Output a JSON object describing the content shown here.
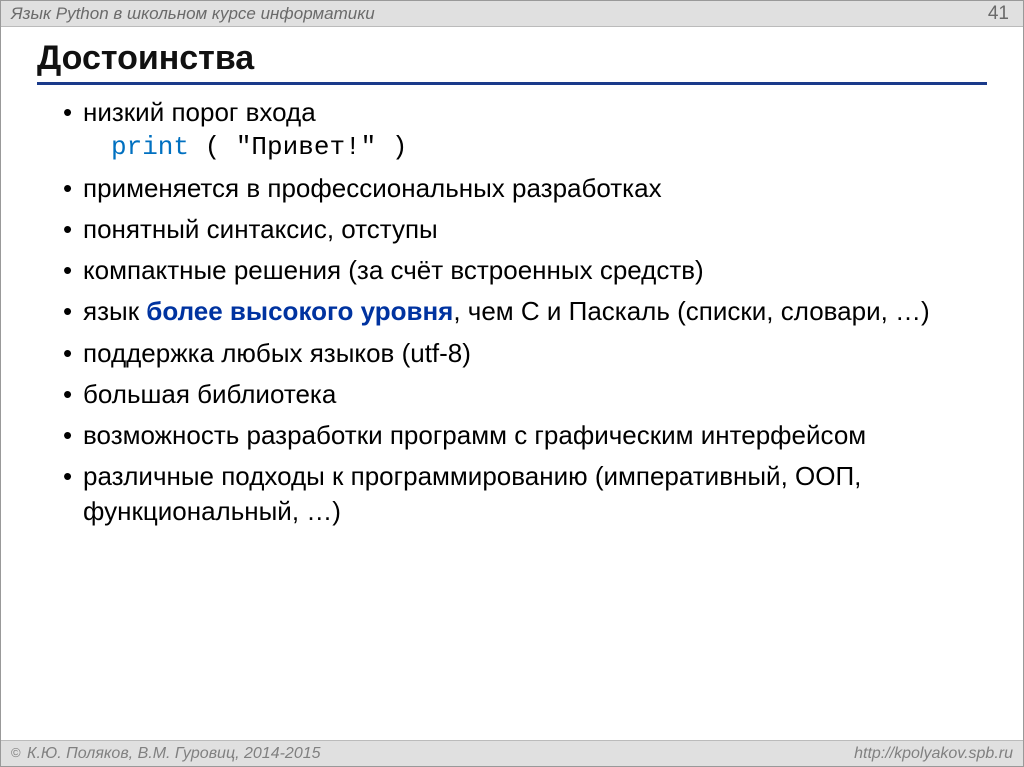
{
  "header": {
    "title": "Язык Python в школьном курсе информатики",
    "page": "41"
  },
  "title": "Достоинства",
  "bullets": {
    "b1_text": "низкий порог входа",
    "b1_code_kw": "print",
    "b1_code_rest": " ( \"Привет!\" )",
    "b2": "применяется в профессиональных разработках",
    "b3": "понятный синтаксис, отступы",
    "b4": "компактные решения (за счёт встроенных средств)",
    "b5_pre": "язык ",
    "b5_emph": "более высокого уровня",
    "b5_post": ", чем C и Паскаль (списки, словари, …)",
    "b6": "поддержка любых языков (utf-8)",
    "b7": "большая библиотека",
    "b8": "возможность разработки программ с графическим интерфейсом",
    "b9": "различные подходы к программированию (императивный, ООП, функциональный, …)"
  },
  "footer": {
    "copyright_symbol": "©",
    "left": " К.Ю. Поляков, В.М. Гуровиц, 2014-2015",
    "right": "http://kpolyakov.spb.ru"
  }
}
